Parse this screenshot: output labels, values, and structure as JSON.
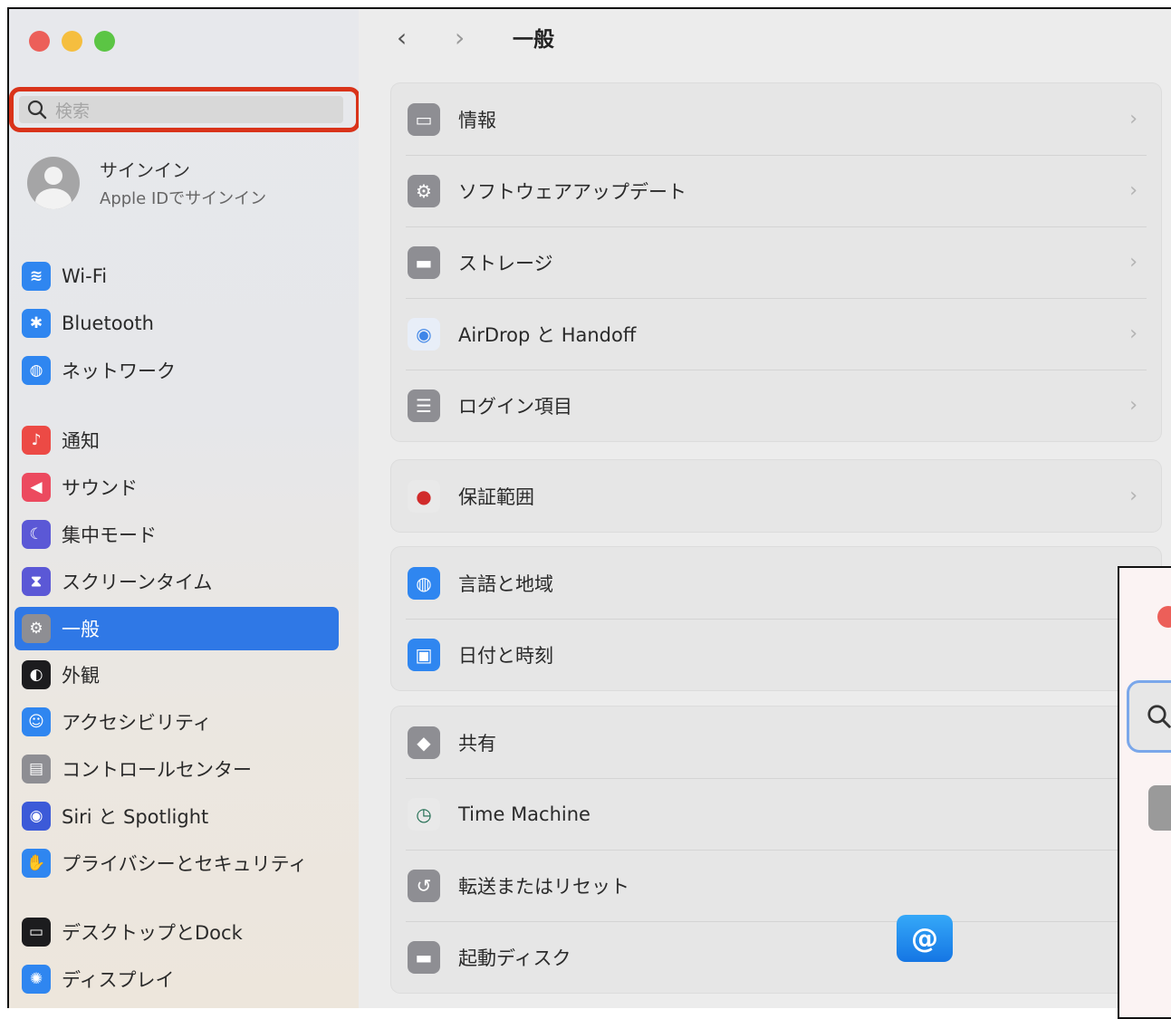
{
  "window": {
    "traffic": [
      "#ec5f59",
      "#f5be3f",
      "#5bc544"
    ]
  },
  "search": {
    "placeholder": "検索"
  },
  "user": {
    "name": "サインイン",
    "subtitle": "Apple IDでサインイン"
  },
  "sidebar": {
    "items": [
      {
        "label": "Wi-Fi",
        "icon": "wifi-icon",
        "color": "#2f86f0",
        "selected": false
      },
      {
        "label": "Bluetooth",
        "icon": "bluetooth-icon",
        "color": "#2f86f0",
        "selected": false
      },
      {
        "label": "ネットワーク",
        "icon": "globe-icon",
        "color": "#2f86f0",
        "selected": false
      },
      {
        "label": "通知",
        "icon": "bell-icon",
        "color": "#ec4a45",
        "selected": false
      },
      {
        "label": "サウンド",
        "icon": "speaker-icon",
        "color": "#ec4a5f",
        "selected": false
      },
      {
        "label": "集中モード",
        "icon": "moon-icon",
        "color": "#5b58d6",
        "selected": false
      },
      {
        "label": "スクリーンタイム",
        "icon": "hourglass-icon",
        "color": "#5b58d6",
        "selected": false
      },
      {
        "label": "一般",
        "icon": "gear-icon",
        "color": "#8e8e93",
        "selected": true
      },
      {
        "label": "外観",
        "icon": "appearance-icon",
        "color": "#1c1c1e",
        "selected": false
      },
      {
        "label": "アクセシビリティ",
        "icon": "accessibility-icon",
        "color": "#2f86f0",
        "selected": false
      },
      {
        "label": "コントロールセンター",
        "icon": "control-center-icon",
        "color": "#8e8e93",
        "selected": false
      },
      {
        "label": "Siri と Spotlight",
        "icon": "siri-icon",
        "color": "#3c5ad8",
        "selected": false
      },
      {
        "label": "プライバシーとセキュリティ",
        "icon": "hand-icon",
        "color": "#2f86f0",
        "selected": false
      },
      {
        "label": "デスクトップとDock",
        "icon": "dock-icon",
        "color": "#1c1c1e",
        "selected": false
      },
      {
        "label": "ディスプレイ",
        "icon": "sun-icon",
        "color": "#2f86f0",
        "selected": false
      }
    ]
  },
  "toolbar": {
    "back": "‹",
    "forward": "›",
    "title": "一般"
  },
  "groups": [
    {
      "rows": [
        {
          "label": "情報",
          "icon": "laptop-icon",
          "color": "#8e8e93"
        },
        {
          "label": "ソフトウェアアップデート",
          "icon": "gear-badge-icon",
          "color": "#8e8e93"
        },
        {
          "label": "ストレージ",
          "icon": "storage-icon",
          "color": "#8e8e93"
        },
        {
          "label": "AirDrop と Handoff",
          "icon": "airdrop-icon",
          "color": "#e8eef8"
        },
        {
          "label": "ログイン項目",
          "icon": "list-icon",
          "color": "#8e8e93"
        }
      ]
    },
    {
      "rows": [
        {
          "label": "保証範囲",
          "icon": "apple-icon",
          "color": "#e9e9e9"
        }
      ]
    },
    {
      "rows": [
        {
          "label": "言語と地域",
          "icon": "globe-icon",
          "color": "#2f86f0"
        },
        {
          "label": "日付と時刻",
          "icon": "calendar-clock-icon",
          "color": "#2f86f0"
        }
      ]
    },
    {
      "rows": [
        {
          "label": "共有",
          "icon": "share-icon",
          "color": "#8e8e93"
        },
        {
          "label": "Time Machine",
          "icon": "time-machine-icon",
          "color": "#e9e9e9"
        },
        {
          "label": "転送またはリセット",
          "icon": "reset-icon",
          "color": "#8e8e93"
        },
        {
          "label": "起動ディスク",
          "icon": "disk-icon",
          "color": "#8e8e93"
        }
      ]
    }
  ],
  "badge": {
    "symbol": "@",
    "icon": "at-sign-icon"
  }
}
